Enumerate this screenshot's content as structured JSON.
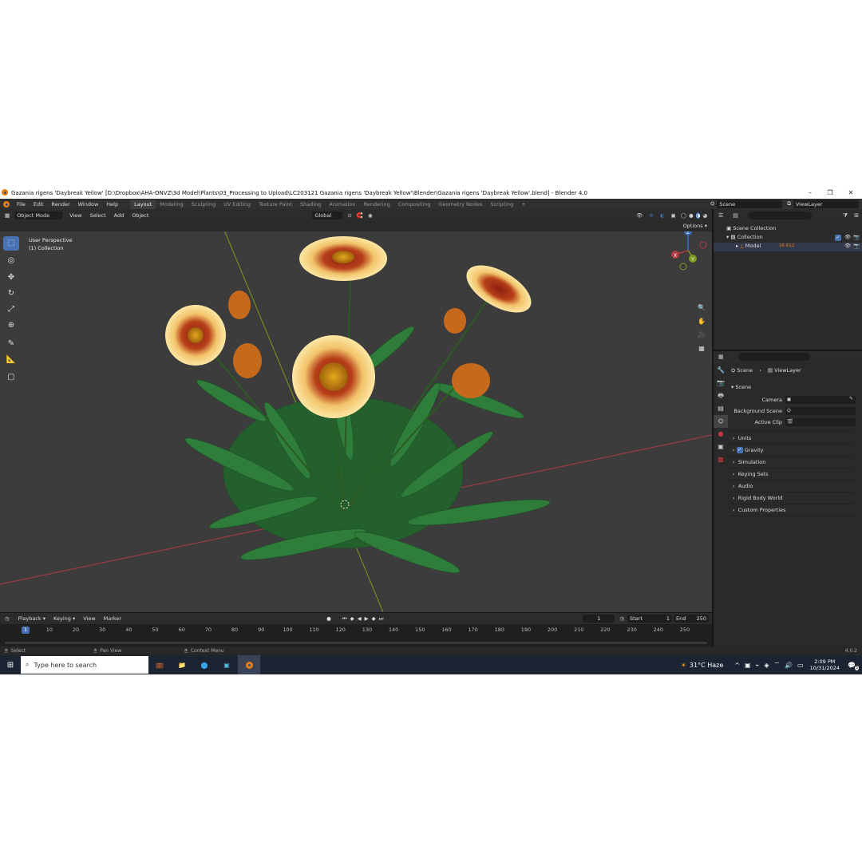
{
  "window": {
    "title": "Gazania rigens 'Daybreak Yellow' [D:\\Dropbox\\AHA-ONVZ\\3d Model\\Plants\\03_Processing to Upload\\LC203121 Gazania rigens 'Daybreak Yellow'\\Blender\\Gazania rigens 'Daybreak Yellow'.blend] - Blender 4.0",
    "controls": {
      "minimize": "–",
      "maximize": "❐",
      "close": "✕"
    }
  },
  "menu": {
    "items": [
      "File",
      "Edit",
      "Render",
      "Window",
      "Help"
    ],
    "workspaces": [
      "Layout",
      "Modeling",
      "Sculpting",
      "UV Editing",
      "Texture Paint",
      "Shading",
      "Animation",
      "Rendering",
      "Compositing",
      "Geometry Nodes",
      "Scripting"
    ],
    "add_tab": "+",
    "scene": "Scene",
    "view_layer": "ViewLayer"
  },
  "viewport": {
    "mode": "Object Mode",
    "menus": [
      "View",
      "Select",
      "Add",
      "Object"
    ],
    "orientation": "Global",
    "options": "Options",
    "overlay_line1": "User Perspective",
    "overlay_line2": "(1) Collection",
    "gizmo": {
      "x": "X",
      "y": "Y",
      "z": "Z"
    }
  },
  "outliner": {
    "scene_collection": "Scene Collection",
    "collection": "Collection",
    "model": "Model",
    "model_badge": "16",
    "model_badge2": "612"
  },
  "properties": {
    "breadcrumb_scene": "Scene",
    "breadcrumb_layer": "ViewLayer",
    "section": "Scene",
    "camera_label": "Camera",
    "background_label": "Background Scene",
    "clip_label": "Active Clip",
    "panels": [
      "Units",
      "Gravity",
      "Simulation",
      "Keying Sets",
      "Audio",
      "Rigid Body World",
      "Custom Properties"
    ]
  },
  "timeline": {
    "menus": [
      "Playback",
      "Keying",
      "View",
      "Marker"
    ],
    "current_frame": "1",
    "start_label": "Start",
    "start": "1",
    "end_label": "End",
    "end": "250",
    "ticks": [
      "1",
      "10",
      "20",
      "30",
      "40",
      "50",
      "60",
      "70",
      "80",
      "90",
      "100",
      "110",
      "120",
      "130",
      "140",
      "150",
      "160",
      "170",
      "180",
      "190",
      "200",
      "210",
      "220",
      "230",
      "240",
      "250"
    ]
  },
  "status": {
    "select": "Select",
    "pan": "Pan View",
    "context": "Context Menu",
    "version": "4.0.2"
  },
  "taskbar": {
    "search_placeholder": "Type here to search",
    "weather": "31°C  Haze",
    "time": "2:09 PM",
    "date": "10/31/2024",
    "notifications": "5"
  },
  "colors": {
    "accent": "#4772b3",
    "blender_orange": "#e87d0d",
    "viewport_bg": "#3c3c3c",
    "x_axis": "#b03a46",
    "y_axis": "#7a9a22"
  }
}
